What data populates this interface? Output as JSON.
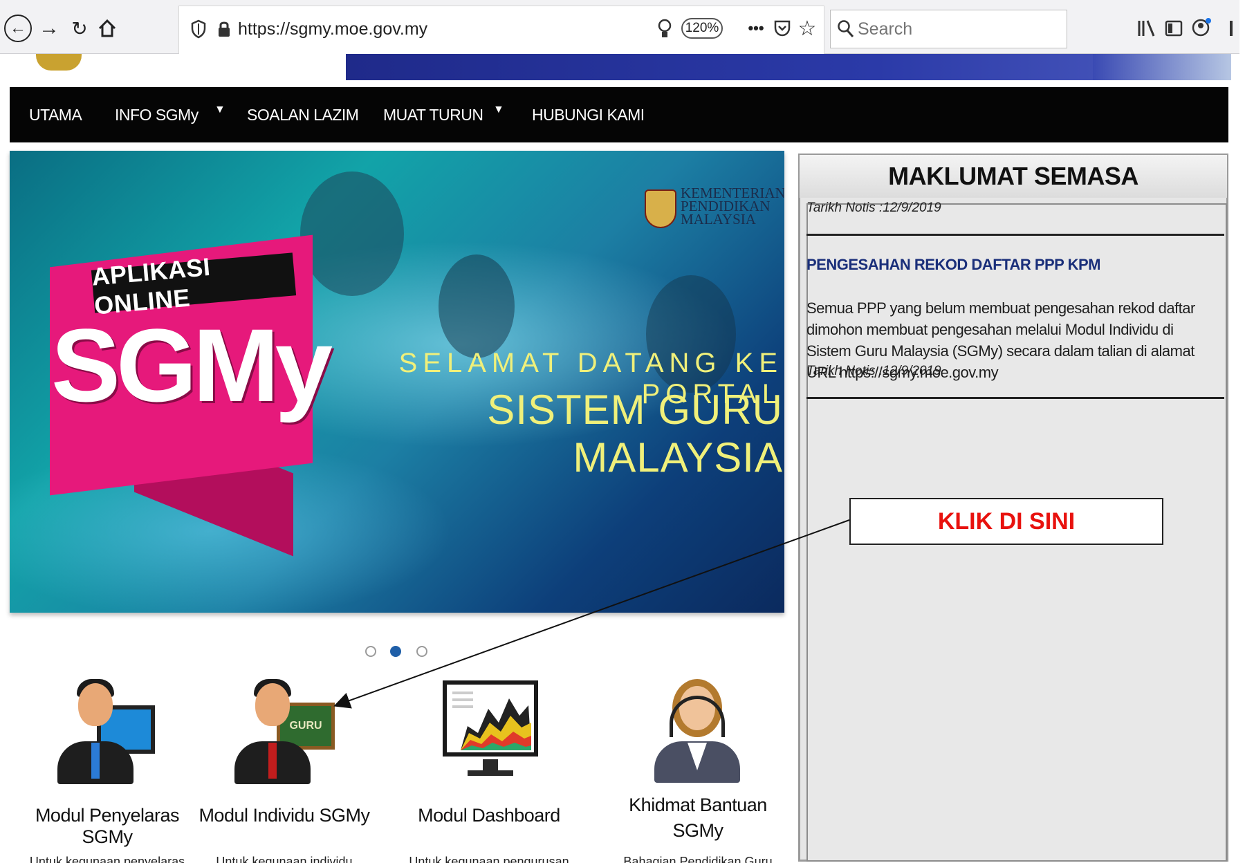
{
  "browser": {
    "url": "https://sgmy.moe.gov.my",
    "zoom": "120%",
    "search_placeholder": "Search"
  },
  "nav": {
    "items": [
      "UTAMA",
      "INFO SGMy",
      "SOALAN LAZIM",
      "MUAT TURUN",
      "HUBUNGI KAMI"
    ]
  },
  "hero": {
    "badge": "APLIKASI ONLINE",
    "brand": "SGMy",
    "welcome_line1": "SELAMAT DATANG KE PORTAL",
    "welcome_line2": "SISTEM GURU MALAYSIA",
    "ministry": [
      "KEMENTERIAN",
      "PENDIDIKAN",
      "MALAYSIA"
    ],
    "icon_label": "GURU",
    "active_slide": 2,
    "slide_count": 3
  },
  "modules": [
    {
      "label": "Modul Penyelaras SGMy",
      "desc": "Untuk kegunaan penyelaras"
    },
    {
      "label": "Modul Individu SGMy",
      "desc": "Untuk kegunaan individu"
    },
    {
      "label": "Modul Dashboard",
      "desc": "Untuk kegunaan pengurusan"
    },
    {
      "label": "Khidmat Bantuan SGMy",
      "desc": "Bahagian Pendidikan Guru"
    }
  ],
  "panel": {
    "title": "MAKLUMAT SEMASA",
    "prev_notice_date": "Tarikh Notis :12/9/2019",
    "notice_title": "PENGESAHAN REKOD DAFTAR PPP KPM",
    "notice_body": "Semua PPP yang belum membuat pengesahan rekod daftar dimohon membuat pengesahan melalui Modul Individu di Sistem Guru Malaysia (SGMy) secara dalam talian di alamat URL https://sgmy.moe.gov.my",
    "notice_date": "Tarikh Notis :12/9/2019"
  },
  "callout": {
    "text": "KLIK DI SINI"
  }
}
